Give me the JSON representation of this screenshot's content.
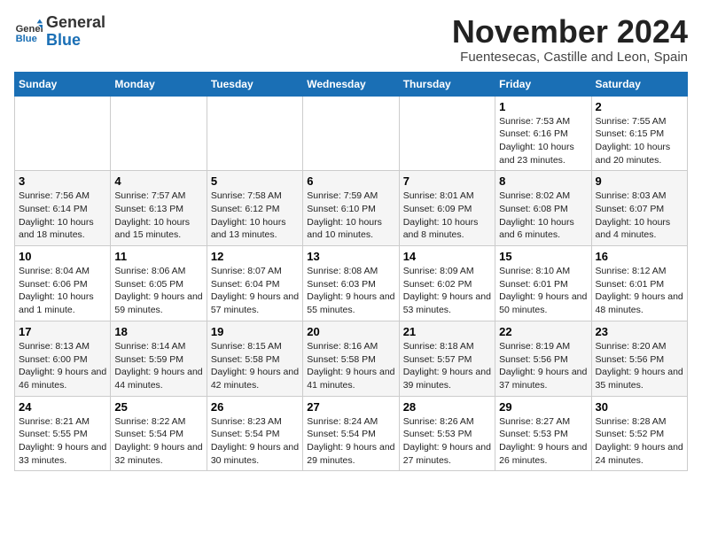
{
  "logo": {
    "general": "General",
    "blue": "Blue"
  },
  "title": "November 2024",
  "location": "Fuentesecas, Castille and Leon, Spain",
  "days_header": [
    "Sunday",
    "Monday",
    "Tuesday",
    "Wednesday",
    "Thursday",
    "Friday",
    "Saturday"
  ],
  "weeks": [
    [
      {
        "num": "",
        "info": ""
      },
      {
        "num": "",
        "info": ""
      },
      {
        "num": "",
        "info": ""
      },
      {
        "num": "",
        "info": ""
      },
      {
        "num": "",
        "info": ""
      },
      {
        "num": "1",
        "info": "Sunrise: 7:53 AM\nSunset: 6:16 PM\nDaylight: 10 hours and 23 minutes."
      },
      {
        "num": "2",
        "info": "Sunrise: 7:55 AM\nSunset: 6:15 PM\nDaylight: 10 hours and 20 minutes."
      }
    ],
    [
      {
        "num": "3",
        "info": "Sunrise: 7:56 AM\nSunset: 6:14 PM\nDaylight: 10 hours and 18 minutes."
      },
      {
        "num": "4",
        "info": "Sunrise: 7:57 AM\nSunset: 6:13 PM\nDaylight: 10 hours and 15 minutes."
      },
      {
        "num": "5",
        "info": "Sunrise: 7:58 AM\nSunset: 6:12 PM\nDaylight: 10 hours and 13 minutes."
      },
      {
        "num": "6",
        "info": "Sunrise: 7:59 AM\nSunset: 6:10 PM\nDaylight: 10 hours and 10 minutes."
      },
      {
        "num": "7",
        "info": "Sunrise: 8:01 AM\nSunset: 6:09 PM\nDaylight: 10 hours and 8 minutes."
      },
      {
        "num": "8",
        "info": "Sunrise: 8:02 AM\nSunset: 6:08 PM\nDaylight: 10 hours and 6 minutes."
      },
      {
        "num": "9",
        "info": "Sunrise: 8:03 AM\nSunset: 6:07 PM\nDaylight: 10 hours and 4 minutes."
      }
    ],
    [
      {
        "num": "10",
        "info": "Sunrise: 8:04 AM\nSunset: 6:06 PM\nDaylight: 10 hours and 1 minute."
      },
      {
        "num": "11",
        "info": "Sunrise: 8:06 AM\nSunset: 6:05 PM\nDaylight: 9 hours and 59 minutes."
      },
      {
        "num": "12",
        "info": "Sunrise: 8:07 AM\nSunset: 6:04 PM\nDaylight: 9 hours and 57 minutes."
      },
      {
        "num": "13",
        "info": "Sunrise: 8:08 AM\nSunset: 6:03 PM\nDaylight: 9 hours and 55 minutes."
      },
      {
        "num": "14",
        "info": "Sunrise: 8:09 AM\nSunset: 6:02 PM\nDaylight: 9 hours and 53 minutes."
      },
      {
        "num": "15",
        "info": "Sunrise: 8:10 AM\nSunset: 6:01 PM\nDaylight: 9 hours and 50 minutes."
      },
      {
        "num": "16",
        "info": "Sunrise: 8:12 AM\nSunset: 6:01 PM\nDaylight: 9 hours and 48 minutes."
      }
    ],
    [
      {
        "num": "17",
        "info": "Sunrise: 8:13 AM\nSunset: 6:00 PM\nDaylight: 9 hours and 46 minutes."
      },
      {
        "num": "18",
        "info": "Sunrise: 8:14 AM\nSunset: 5:59 PM\nDaylight: 9 hours and 44 minutes."
      },
      {
        "num": "19",
        "info": "Sunrise: 8:15 AM\nSunset: 5:58 PM\nDaylight: 9 hours and 42 minutes."
      },
      {
        "num": "20",
        "info": "Sunrise: 8:16 AM\nSunset: 5:58 PM\nDaylight: 9 hours and 41 minutes."
      },
      {
        "num": "21",
        "info": "Sunrise: 8:18 AM\nSunset: 5:57 PM\nDaylight: 9 hours and 39 minutes."
      },
      {
        "num": "22",
        "info": "Sunrise: 8:19 AM\nSunset: 5:56 PM\nDaylight: 9 hours and 37 minutes."
      },
      {
        "num": "23",
        "info": "Sunrise: 8:20 AM\nSunset: 5:56 PM\nDaylight: 9 hours and 35 minutes."
      }
    ],
    [
      {
        "num": "24",
        "info": "Sunrise: 8:21 AM\nSunset: 5:55 PM\nDaylight: 9 hours and 33 minutes."
      },
      {
        "num": "25",
        "info": "Sunrise: 8:22 AM\nSunset: 5:54 PM\nDaylight: 9 hours and 32 minutes."
      },
      {
        "num": "26",
        "info": "Sunrise: 8:23 AM\nSunset: 5:54 PM\nDaylight: 9 hours and 30 minutes."
      },
      {
        "num": "27",
        "info": "Sunrise: 8:24 AM\nSunset: 5:54 PM\nDaylight: 9 hours and 29 minutes."
      },
      {
        "num": "28",
        "info": "Sunrise: 8:26 AM\nSunset: 5:53 PM\nDaylight: 9 hours and 27 minutes."
      },
      {
        "num": "29",
        "info": "Sunrise: 8:27 AM\nSunset: 5:53 PM\nDaylight: 9 hours and 26 minutes."
      },
      {
        "num": "30",
        "info": "Sunrise: 8:28 AM\nSunset: 5:52 PM\nDaylight: 9 hours and 24 minutes."
      }
    ]
  ]
}
